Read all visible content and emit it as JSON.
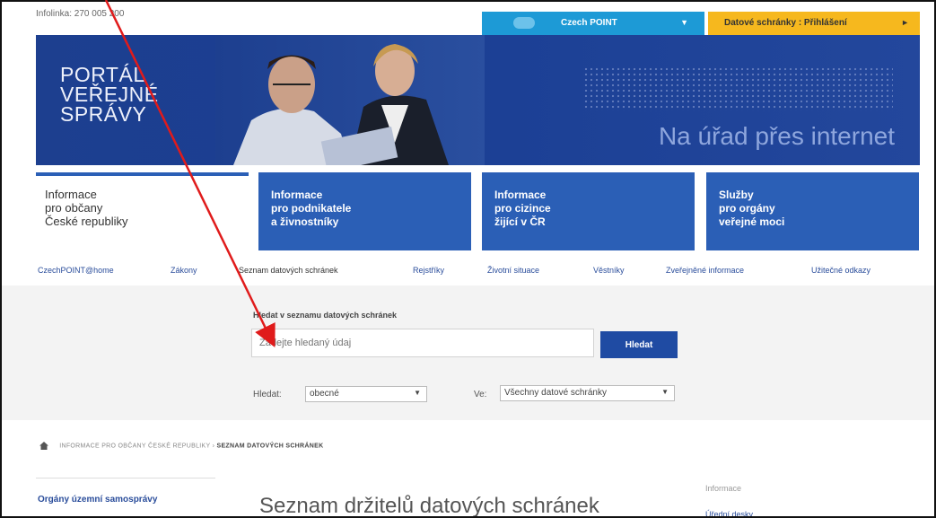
{
  "topbar": {
    "infolinka": "Infolinka: 270 005 200",
    "czechpoint_label": "Czech POINT",
    "datovky_label": "Datové schránky : Přihlášení"
  },
  "banner": {
    "logo_line1": "PORTÁL",
    "logo_line2": "VEŘEJNÉ",
    "logo_line3": "SPRÁVY",
    "tagline": "Na úřad přes internet"
  },
  "nav_boxes": [
    {
      "line1": "Informace",
      "line2": "pro občany",
      "line3": "České republiky"
    },
    {
      "line1": "Informace",
      "line2": "pro podnikatele",
      "line3": "a živnostníky"
    },
    {
      "line1": "Informace",
      "line2": "pro cizince",
      "line3": "žijící v ČR"
    },
    {
      "line1": "Služby",
      "line2": "pro orgány",
      "line3": "veřejné moci"
    }
  ],
  "subnav": [
    "CzechPOINT@home",
    "Zákony",
    "Seznam datových schránek",
    "Rejstříky",
    "Životní situace",
    "Věstníky",
    "Zveřejněné informace",
    "Užitečné odkazy"
  ],
  "search": {
    "title": "Hledat v seznamu datových schránek",
    "placeholder": "Zadejte hledaný údaj",
    "button": "Hledat",
    "hledat_label": "Hledat:",
    "hledat_value": "obecné",
    "ve_label": "Ve:",
    "ve_value": "Všechny datové schránky"
  },
  "breadcrumb": {
    "parent": "INFORMACE PRO OBČANY ČESKÉ REPUBLIKY",
    "separator": "›",
    "current": "SEZNAM DATOVÝCH SCHRÁNEK"
  },
  "content": {
    "left_item": "Orgány územní samosprávy",
    "heading": "Seznam držitelů datových schránek",
    "right_info": "Informace",
    "right_link": "Úřední desky"
  },
  "colors": {
    "primary_blue": "#2b5fb6",
    "czechpoint": "#1d9ad6",
    "datovky": "#f6b81e",
    "annotation_arrow": "#e01b1b"
  }
}
